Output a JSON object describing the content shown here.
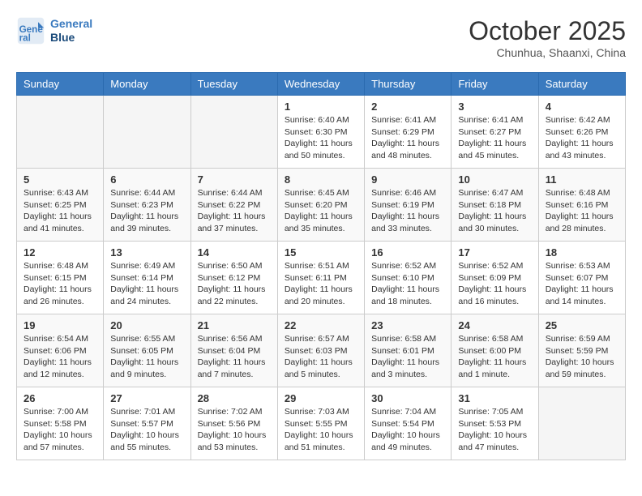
{
  "header": {
    "logo_line1": "General",
    "logo_line2": "Blue",
    "month": "October 2025",
    "location": "Chunhua, Shaanxi, China"
  },
  "weekdays": [
    "Sunday",
    "Monday",
    "Tuesday",
    "Wednesday",
    "Thursday",
    "Friday",
    "Saturday"
  ],
  "weeks": [
    [
      {
        "day": "",
        "info": ""
      },
      {
        "day": "",
        "info": ""
      },
      {
        "day": "",
        "info": ""
      },
      {
        "day": "1",
        "info": "Sunrise: 6:40 AM\nSunset: 6:30 PM\nDaylight: 11 hours and 50 minutes."
      },
      {
        "day": "2",
        "info": "Sunrise: 6:41 AM\nSunset: 6:29 PM\nDaylight: 11 hours and 48 minutes."
      },
      {
        "day": "3",
        "info": "Sunrise: 6:41 AM\nSunset: 6:27 PM\nDaylight: 11 hours and 45 minutes."
      },
      {
        "day": "4",
        "info": "Sunrise: 6:42 AM\nSunset: 6:26 PM\nDaylight: 11 hours and 43 minutes."
      }
    ],
    [
      {
        "day": "5",
        "info": "Sunrise: 6:43 AM\nSunset: 6:25 PM\nDaylight: 11 hours and 41 minutes."
      },
      {
        "day": "6",
        "info": "Sunrise: 6:44 AM\nSunset: 6:23 PM\nDaylight: 11 hours and 39 minutes."
      },
      {
        "day": "7",
        "info": "Sunrise: 6:44 AM\nSunset: 6:22 PM\nDaylight: 11 hours and 37 minutes."
      },
      {
        "day": "8",
        "info": "Sunrise: 6:45 AM\nSunset: 6:20 PM\nDaylight: 11 hours and 35 minutes."
      },
      {
        "day": "9",
        "info": "Sunrise: 6:46 AM\nSunset: 6:19 PM\nDaylight: 11 hours and 33 minutes."
      },
      {
        "day": "10",
        "info": "Sunrise: 6:47 AM\nSunset: 6:18 PM\nDaylight: 11 hours and 30 minutes."
      },
      {
        "day": "11",
        "info": "Sunrise: 6:48 AM\nSunset: 6:16 PM\nDaylight: 11 hours and 28 minutes."
      }
    ],
    [
      {
        "day": "12",
        "info": "Sunrise: 6:48 AM\nSunset: 6:15 PM\nDaylight: 11 hours and 26 minutes."
      },
      {
        "day": "13",
        "info": "Sunrise: 6:49 AM\nSunset: 6:14 PM\nDaylight: 11 hours and 24 minutes."
      },
      {
        "day": "14",
        "info": "Sunrise: 6:50 AM\nSunset: 6:12 PM\nDaylight: 11 hours and 22 minutes."
      },
      {
        "day": "15",
        "info": "Sunrise: 6:51 AM\nSunset: 6:11 PM\nDaylight: 11 hours and 20 minutes."
      },
      {
        "day": "16",
        "info": "Sunrise: 6:52 AM\nSunset: 6:10 PM\nDaylight: 11 hours and 18 minutes."
      },
      {
        "day": "17",
        "info": "Sunrise: 6:52 AM\nSunset: 6:09 PM\nDaylight: 11 hours and 16 minutes."
      },
      {
        "day": "18",
        "info": "Sunrise: 6:53 AM\nSunset: 6:07 PM\nDaylight: 11 hours and 14 minutes."
      }
    ],
    [
      {
        "day": "19",
        "info": "Sunrise: 6:54 AM\nSunset: 6:06 PM\nDaylight: 11 hours and 12 minutes."
      },
      {
        "day": "20",
        "info": "Sunrise: 6:55 AM\nSunset: 6:05 PM\nDaylight: 11 hours and 9 minutes."
      },
      {
        "day": "21",
        "info": "Sunrise: 6:56 AM\nSunset: 6:04 PM\nDaylight: 11 hours and 7 minutes."
      },
      {
        "day": "22",
        "info": "Sunrise: 6:57 AM\nSunset: 6:03 PM\nDaylight: 11 hours and 5 minutes."
      },
      {
        "day": "23",
        "info": "Sunrise: 6:58 AM\nSunset: 6:01 PM\nDaylight: 11 hours and 3 minutes."
      },
      {
        "day": "24",
        "info": "Sunrise: 6:58 AM\nSunset: 6:00 PM\nDaylight: 11 hours and 1 minute."
      },
      {
        "day": "25",
        "info": "Sunrise: 6:59 AM\nSunset: 5:59 PM\nDaylight: 10 hours and 59 minutes."
      }
    ],
    [
      {
        "day": "26",
        "info": "Sunrise: 7:00 AM\nSunset: 5:58 PM\nDaylight: 10 hours and 57 minutes."
      },
      {
        "day": "27",
        "info": "Sunrise: 7:01 AM\nSunset: 5:57 PM\nDaylight: 10 hours and 55 minutes."
      },
      {
        "day": "28",
        "info": "Sunrise: 7:02 AM\nSunset: 5:56 PM\nDaylight: 10 hours and 53 minutes."
      },
      {
        "day": "29",
        "info": "Sunrise: 7:03 AM\nSunset: 5:55 PM\nDaylight: 10 hours and 51 minutes."
      },
      {
        "day": "30",
        "info": "Sunrise: 7:04 AM\nSunset: 5:54 PM\nDaylight: 10 hours and 49 minutes."
      },
      {
        "day": "31",
        "info": "Sunrise: 7:05 AM\nSunset: 5:53 PM\nDaylight: 10 hours and 47 minutes."
      },
      {
        "day": "",
        "info": ""
      }
    ]
  ]
}
